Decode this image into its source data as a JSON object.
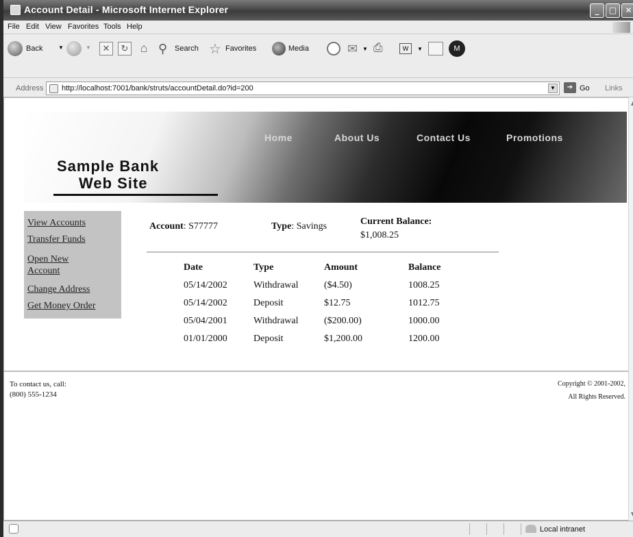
{
  "window": {
    "title": "Account Detail - Microsoft Internet Explorer",
    "controls": [
      "minimize",
      "maximize",
      "close"
    ]
  },
  "menu": [
    "File",
    "Edit",
    "View",
    "Favorites",
    "Tools",
    "Help"
  ],
  "toolbar": {
    "back": "Back",
    "search": "Search",
    "favorites": "Favorites",
    "media": "Media"
  },
  "address": {
    "label": "Address",
    "url": "http://localhost:7001/bank/struts/accountDetail.do?id=200",
    "go": "Go",
    "links": "Links"
  },
  "site": {
    "nav": [
      "Home",
      "About Us",
      "Contact Us",
      "Promotions"
    ],
    "brand_line1": "Sample Bank",
    "brand_line2": "Web Site"
  },
  "sidebar": [
    "View Accounts",
    "Transfer Funds",
    "Open New",
    "Account",
    "Change Address",
    "Get Money Order"
  ],
  "account": {
    "account_label": "Account",
    "account_value": ": S77777",
    "type_label": "Type",
    "type_value": ": Savings",
    "balance_label": "Current Balance:",
    "balance_value": "$1,008.25"
  },
  "transactions": {
    "headers": [
      "Date",
      "Type",
      "Amount",
      "Balance"
    ],
    "rows": [
      [
        "05/14/2002",
        "Withdrawal",
        "($4.50)",
        "1008.25"
      ],
      [
        "05/14/2002",
        "Deposit",
        "$12.75",
        "1012.75"
      ],
      [
        "05/04/2001",
        "Withdrawal",
        "($200.00)",
        "1000.00"
      ],
      [
        "01/01/2000",
        "Deposit",
        "$1,200.00",
        "1200.00"
      ]
    ]
  },
  "footer": {
    "contact_line1": "To contact us, call:",
    "contact_line2": "(800) 555-1234",
    "copyright_line1": "Copyright © 2001-2002,",
    "copyright_line2": "All Rights Reserved."
  },
  "status": {
    "zone": "Local intranet"
  }
}
